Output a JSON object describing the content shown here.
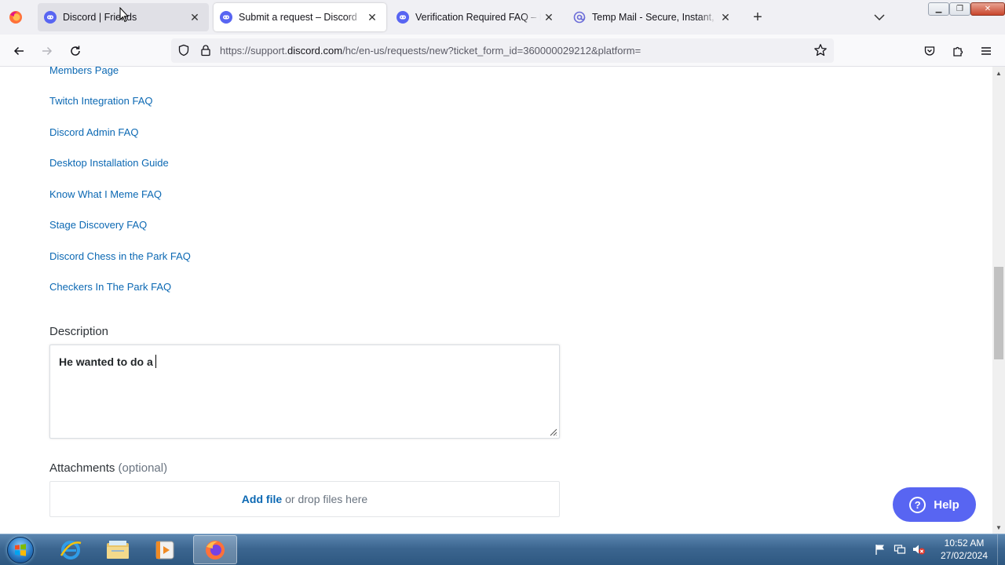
{
  "browser": {
    "tabs": [
      {
        "title": "Discord | Friends",
        "state": "hover"
      },
      {
        "title": "Submit a request – Discord",
        "state": "active"
      },
      {
        "title": "Verification Required FAQ – Discord",
        "state": "normal"
      },
      {
        "title": "Temp Mail - Secure, Instant, Fast",
        "state": "normal"
      }
    ],
    "url_prefix": "https://support.",
    "url_domain": "discord.com",
    "url_suffix": "/hc/en-us/requests/new?ticket_form_id=360000029212&platform="
  },
  "page": {
    "links": [
      "Members Page",
      "Twitch Integration FAQ",
      "Discord Admin FAQ",
      "Desktop Installation Guide",
      "Know What I Meme FAQ",
      "Stage Discovery FAQ",
      "Discord Chess in the Park FAQ",
      "Checkers In The Park FAQ"
    ],
    "description_label": "Description",
    "description_value": "He wanted to do a",
    "attachments_label": "Attachments",
    "attachments_optional": "(optional)",
    "add_file": "Add file",
    "drop_text": "or drop files here",
    "help_label": "Help"
  },
  "taskbar": {
    "time": "10:52 AM",
    "date": "27/02/2024"
  },
  "colors": {
    "link": "#0b68b3",
    "discord_blurple": "#5865f2"
  }
}
